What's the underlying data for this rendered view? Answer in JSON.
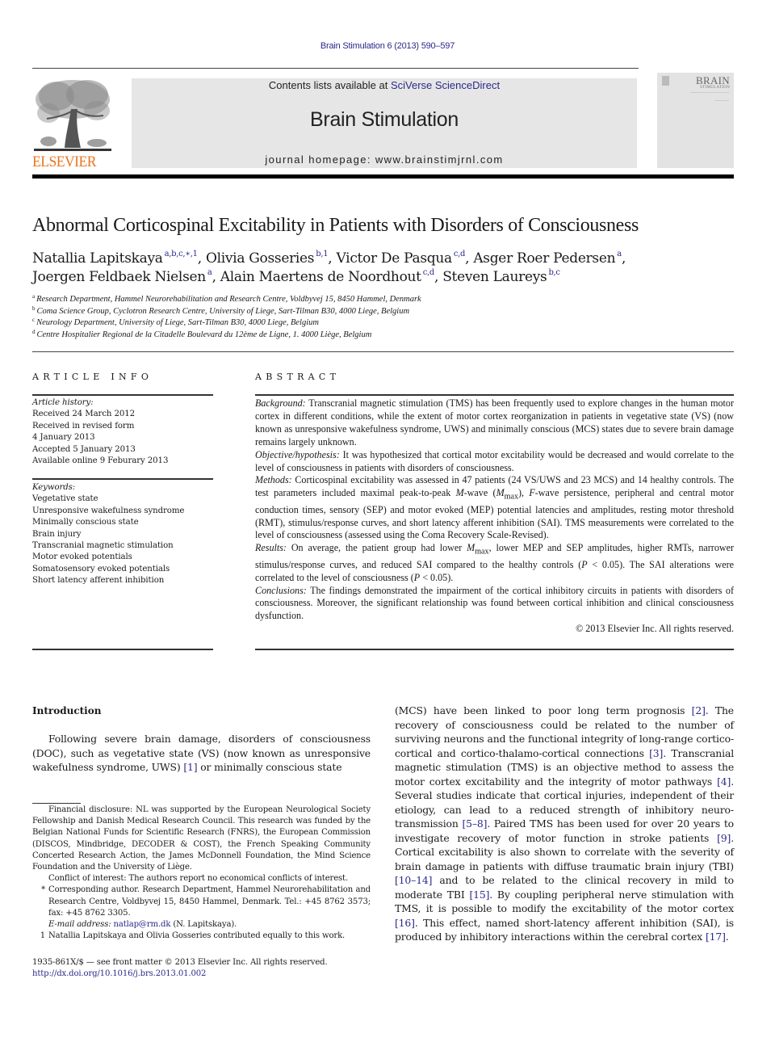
{
  "header": {
    "running_head": "Brain Stimulation 6 (2013) 590–597",
    "contents_prefix": "Contents lists available at ",
    "contents_link": "SciVerse ScienceDirect",
    "journal_title": "Brain Stimulation",
    "journal_homepage": "journal homepage: www.brainstimjrnl.com",
    "publisher_wordmark": "ELSEVIER",
    "cover_title": "BRAIN",
    "cover_subtitle": "STIMULATION",
    "colors": {
      "link": "#2a2a8a",
      "elsevier_orange": "#e9751e",
      "masthead_gray": "#e6e6e6"
    }
  },
  "article": {
    "title": "Abnormal Corticospinal Excitability in Patients with Disorders of Consciousness",
    "authors": [
      {
        "name": "Natallia Lapitskaya",
        "sup": "a,b,c,∗,1",
        "sep": ", "
      },
      {
        "name": "Olivia Gosseries",
        "sup": "b,1",
        "sep": ", "
      },
      {
        "name": "Victor De Pasqua",
        "sup": "c,d",
        "sep": ", "
      },
      {
        "name": "Asger Roer Pedersen",
        "sup": "a",
        "sep": ","
      },
      {
        "name": "Joergen Feldbaek Nielsen",
        "sup": "a",
        "sep": ", "
      },
      {
        "name": "Alain Maertens de Noordhout",
        "sup": "c,d",
        "sep": ", "
      },
      {
        "name": "Steven Laureys",
        "sup": "b,c",
        "sep": ""
      }
    ],
    "affiliations": [
      {
        "mark": "a",
        "text": "Research Department, Hammel Neurorehabilitation and Research Centre, Voldbyvej 15, 8450 Hammel, Denmark"
      },
      {
        "mark": "b",
        "text": "Coma Science Group, Cyclotron Research Centre, University of Liege, Sart-Tilman B30, 4000 Liege, Belgium"
      },
      {
        "mark": "c",
        "text": "Neurology Department, University of Liege, Sart-Tilman B30, 4000 Liege, Belgium"
      },
      {
        "mark": "d",
        "text": "Centre Hospitalier Regional de la Citadelle Boulevard du 12ème de Ligne, 1. 4000 Liège, Belgium"
      }
    ]
  },
  "article_info": {
    "heading": "ARTICLE INFO",
    "history_label": "Article history:",
    "history": [
      "Received 24 March 2012",
      "Received in revised form",
      "4 January 2013",
      "Accepted 5 January 2013",
      "Available online 9 Feburary 2013"
    ],
    "keywords_label": "Keywords:",
    "keywords": [
      "Vegetative state",
      "Unresponsive wakefulness syndrome",
      "Minimally conscious state",
      "Brain injury",
      "Transcranial magnetic stimulation",
      "Motor evoked potentials",
      "Somatosensory evoked potentials",
      "Short latency afferent inhibition"
    ]
  },
  "abstract": {
    "heading": "ABSTRACT",
    "background_label": "Background:",
    "background": " Transcranial magnetic stimulation (TMS) has been frequently used to explore changes in the human motor cortex in different conditions, while the extent of motor cortex reorganization in patients in vegetative state (VS) (now known as unresponsive wakefulness syndrome, UWS) and minimally conscious (MCS) states due to severe brain damage remains largely unknown.",
    "objective_label": "Objective/hypothesis:",
    "objective": " It was hypothesized that cortical motor excitability would be decreased and would correlate to the level of consciousness in patients with disorders of consciousness.",
    "methods_label": "Methods:",
    "methods_1": " Corticospinal excitability was assessed in 47 patients (24 VS/UWS and 23 MCS) and 14 healthy controls. The test parameters included maximal peak-to-peak ",
    "methods_m": "M",
    "methods_2": "-wave (",
    "methods_mmax": "M",
    "methods_max_sub": "max",
    "methods_3": "), ",
    "methods_f": "F",
    "methods_4": "-wave persistence, peripheral and central motor conduction times, sensory (SEP) and motor evoked (MEP) potential latencies and amplitudes, resting motor threshold (RMT), stimulus/response curves, and short latency afferent inhibition (SAI). TMS measurements were correlated to the level of consciousness (assessed using the Coma Recovery Scale-Revised).",
    "results_label": "Results:",
    "results_1": " On average, the patient group had lower ",
    "results_m": "M",
    "results_sub": "max",
    "results_2": ", lower MEP and SEP amplitudes, higher RMTs, narrower stimulus/response curves, and reduced SAI compared to the healthy controls (",
    "results_p1": "P",
    "results_3": " < 0.05). The SAI alterations were correlated to the level of consciousness (",
    "results_p2": "P",
    "results_4": " < 0.05).",
    "conclusions_label": "Conclusions:",
    "conclusions": " The findings demonstrated the impairment of the cortical inhibitory circuits in patients with disorders of consciousness. Moreover, the significant relationship was found between cortical inhibition and clinical consciousness dysfunction.",
    "copyright": "© 2013 Elsevier Inc. All rights reserved."
  },
  "introduction": {
    "heading": "Introduction",
    "left_1": "Following severe brain damage, disorders of consciousness (DOC), such as vegetative state (VS) (now known as unresponsive wakefulness syndrome, UWS) ",
    "left_cite_1": "[1]",
    "left_2": " or minimally conscious state",
    "right_1": "(MCS) have been linked to poor long term prognosis ",
    "cite_2": "[2]",
    "right_2": ". The recovery of consciousness could be related to the number of surviving neurons and the functional integrity of long-range cor­tico-cortical and cortico-thalamo-cortical connections ",
    "cite_3": "[3]",
    "right_3": ". Trans­cranial magnetic stimulation (TMS) is an objective method to assess the motor cortex excitability and the integrity of motor pathways ",
    "cite_4": "[4]",
    "right_4": ". Several studies indicate that cortical injuries, independent of their etiology, can lead to a reduced strength of inhibitory neuro­transmission ",
    "cite_5": "[5–8]",
    "right_5": ". Paired TMS has been used for over 20 years to investigate recovery of motor function in stroke patients ",
    "cite_9": "[9]",
    "right_6": ". Cortical excitability is also shown to correlate with the severity of brain damage in patients with diffuse traumatic brain injury (TBI) ",
    "cite_10": "[10–14]",
    "right_7": " and to be related to the clinical recovery in mild to moderate TBI ",
    "cite_15": "[15]",
    "right_8": ". By coupling peripheral nerve stimulation with TMS, it is possible to modify the excitability of the motor cortex ",
    "cite_16": "[16]",
    "right_9": ". This effect, named short-latency afferent inhibition (SAI), is produced by inhibitory interactions within the cerebral cortex ",
    "cite_17": "[17]",
    "right_10": "."
  },
  "footnotes": {
    "financial": "Financial disclosure: NL was supported by the European Neurological Society Fellowship and Danish Medical Research Council. This research was funded by the Belgian National Funds for Scientific Research (FNRS), the European Commission (DISCOS, Mindbridge, DECODER & COST), the French Speaking Community Concerted Research Action, the James McDonnell Foundation, the Mind Science Foundation and the University of Liège.",
    "conflict": "Conflict of interest: The authors report no economical conflicts of interest.",
    "corresponding_mark": "*",
    "corresponding": "Corresponding author. Research Department, Hammel Neurorehabilitation and Research Centre, Voldbyvej 15, 8450 Hammel, Denmark. Tel.: +45 8762 3573; fax: +45 8762 3305.",
    "email_label": "E-mail address:",
    "email": "natlap@rm.dk",
    "email_suffix": " (N. Lapitskaya).",
    "equal_mark": "1",
    "equal": "Natallia Lapitskaya and Olivia Gosseries contributed equally to this work.",
    "front_matter": "1935-861X/$ — see front matter © 2013 Elsevier Inc. All rights reserved.",
    "doi": "http://dx.doi.org/10.1016/j.brs.2013.01.002"
  }
}
